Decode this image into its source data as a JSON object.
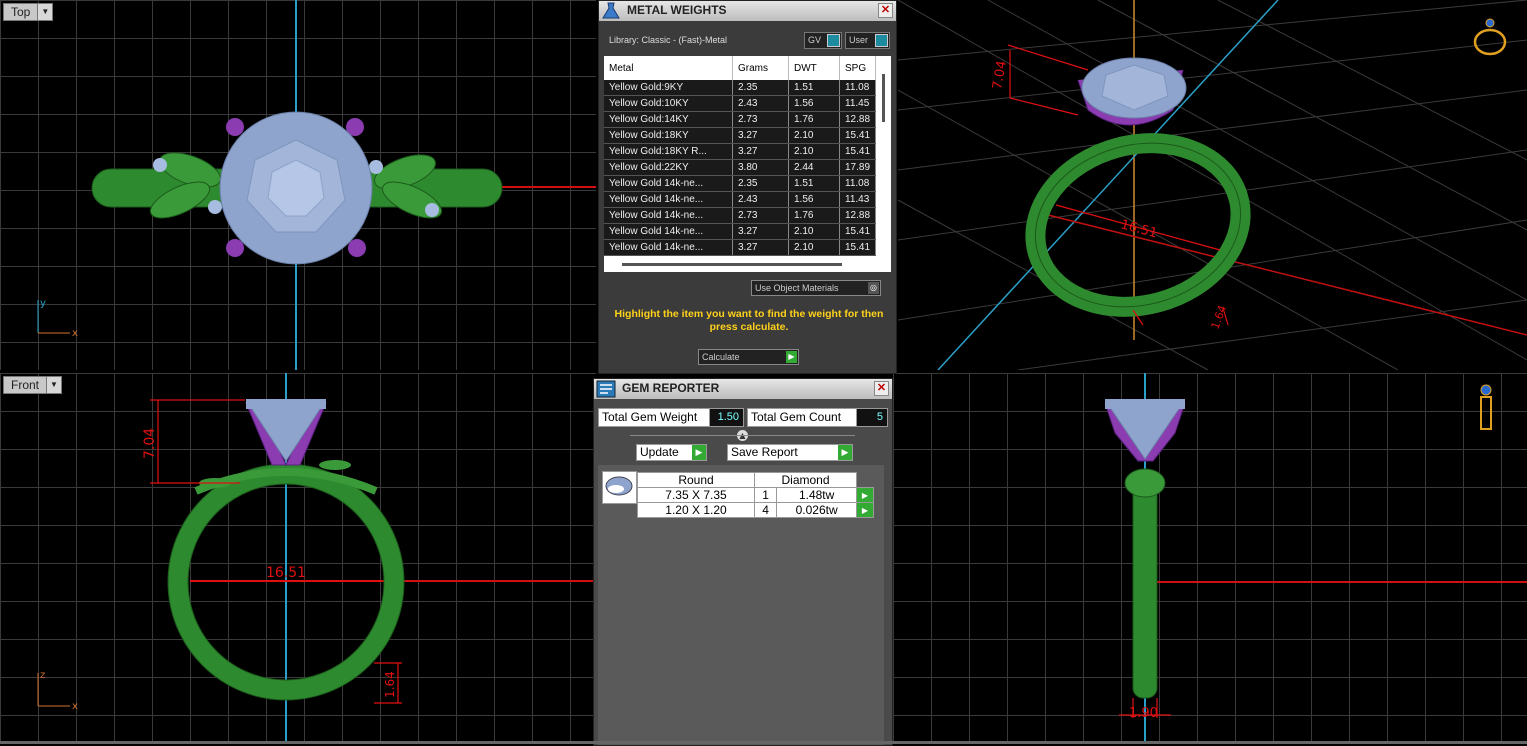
{
  "viewports": {
    "top": {
      "label": "Top"
    },
    "front": {
      "label": "Front"
    }
  },
  "dimensions": {
    "prong_height": "7.04",
    "ring_size": "16.51",
    "band_thickness": "1.64",
    "band_width": "1.90",
    "persp_height": "7.04",
    "persp_size": "16.51",
    "persp_small": "1.64"
  },
  "metal_weights": {
    "title": "METAL WEIGHTS",
    "library": "Library: Classic - (Fast)-Metal",
    "toggle_gv": "GV",
    "toggle_user": "User",
    "columns": [
      "Metal",
      "Grams",
      "DWT",
      "SPG"
    ],
    "rows": [
      [
        "Yellow Gold:9KY",
        "2.35",
        "1.51",
        "11.08"
      ],
      [
        "Yellow Gold:10KY",
        "2.43",
        "1.56",
        "11.45"
      ],
      [
        "Yellow Gold:14KY",
        "2.73",
        "1.76",
        "12.88"
      ],
      [
        "Yellow Gold:18KY",
        "3.27",
        "2.10",
        "15.41"
      ],
      [
        "Yellow Gold:18KY R...",
        "3.27",
        "2.10",
        "15.41"
      ],
      [
        "Yellow Gold:22KY",
        "3.80",
        "2.44",
        "17.89"
      ],
      [
        "Yellow Gold 14k-ne...",
        "2.35",
        "1.51",
        "11.08"
      ],
      [
        "Yellow Gold 14k-ne...",
        "2.43",
        "1.56",
        "11.43"
      ],
      [
        "Yellow Gold 14k-ne...",
        "2.73",
        "1.76",
        "12.88"
      ],
      [
        "Yellow Gold 14k-ne...",
        "3.27",
        "2.10",
        "15.41"
      ],
      [
        "Yellow Gold 14k-ne...",
        "3.27",
        "2.10",
        "15.41"
      ]
    ],
    "use_object_materials": "Use Object Materials",
    "hint": "Highlight the item you want to find the weight for then press calculate.",
    "calculate": "Calculate"
  },
  "gem_reporter": {
    "title": "GEM REPORTER",
    "total_weight_label": "Total Gem Weight",
    "total_weight": "1.50",
    "total_count_label": "Total Gem Count",
    "total_count": "5",
    "update": "Update",
    "save_report": "Save Report",
    "shape": "Round",
    "type": "Diamond",
    "rows": [
      {
        "size": "7.35 X 7.35",
        "qty": "1",
        "weight": "1.48tw"
      },
      {
        "size": "1.20 X 1.20",
        "qty": "4",
        "weight": "0.026tw"
      }
    ]
  },
  "colors": {
    "band": "#2e8a2e",
    "prong": "#8a3cb0",
    "gem": "#8fa4cc",
    "dimension": "#e01010",
    "axis_blue": "#2aa0c8"
  }
}
